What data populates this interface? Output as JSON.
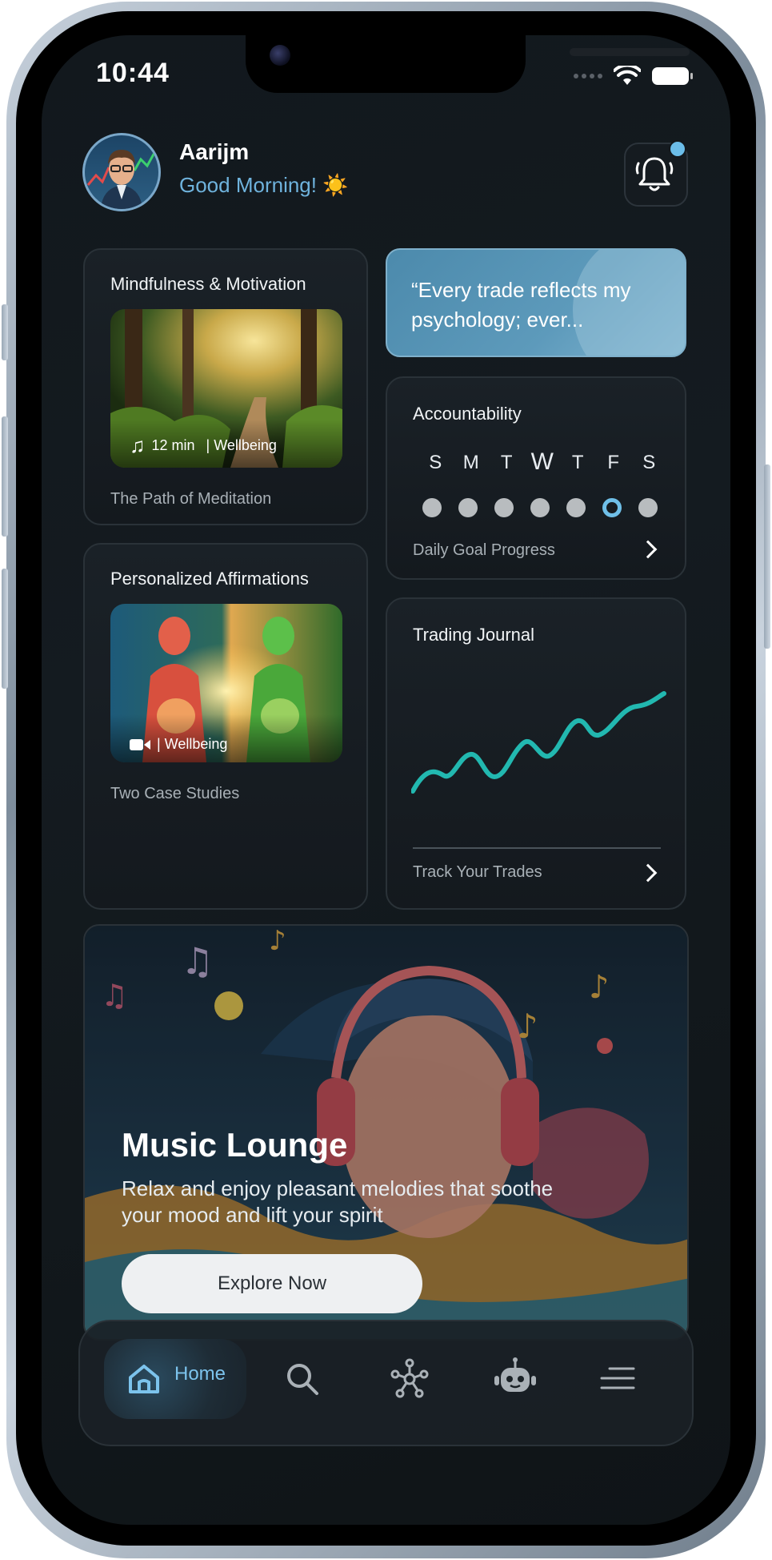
{
  "status_bar": {
    "time": "10:44"
  },
  "header": {
    "user_name": "Aarijm",
    "greeting": "Good Morning! ☀️"
  },
  "cards": {
    "mindfulness": {
      "title": "Mindfulness & Motivation",
      "duration": "12 min",
      "category": "| Wellbeing",
      "subtitle": "The Path of Meditation"
    },
    "quote": {
      "text": "“Every trade reflects my psychology; ever..."
    },
    "accountability": {
      "title": "Accountability",
      "days": [
        "S",
        "M",
        "T",
        "W",
        "T",
        "F",
        "S"
      ],
      "active_day_index": 5,
      "footer": "Daily Goal Progress"
    },
    "affirmations": {
      "title": "Personalized Affirmations",
      "category": "| Wellbeing",
      "subtitle": "Two Case Studies"
    },
    "trading_journal": {
      "title": "Trading Journal",
      "footer": "Track Your Trades"
    },
    "music_lounge": {
      "title": "Music Lounge",
      "description": "Relax and enjoy pleasant melodies that soothe your mood and lift your spirit",
      "button_label": "Explore Now"
    }
  },
  "tab_bar": {
    "items": [
      {
        "label": "Home",
        "icon": "home-icon",
        "active": true
      },
      {
        "label": "",
        "icon": "search-icon",
        "active": false
      },
      {
        "label": "",
        "icon": "network-icon",
        "active": false
      },
      {
        "label": "",
        "icon": "robot-icon",
        "active": false
      },
      {
        "label": "",
        "icon": "menu-icon",
        "active": false
      }
    ]
  },
  "colors": {
    "accent": "#6fb3dd",
    "background": "#12181d",
    "chart_line": "#22b8b0"
  }
}
